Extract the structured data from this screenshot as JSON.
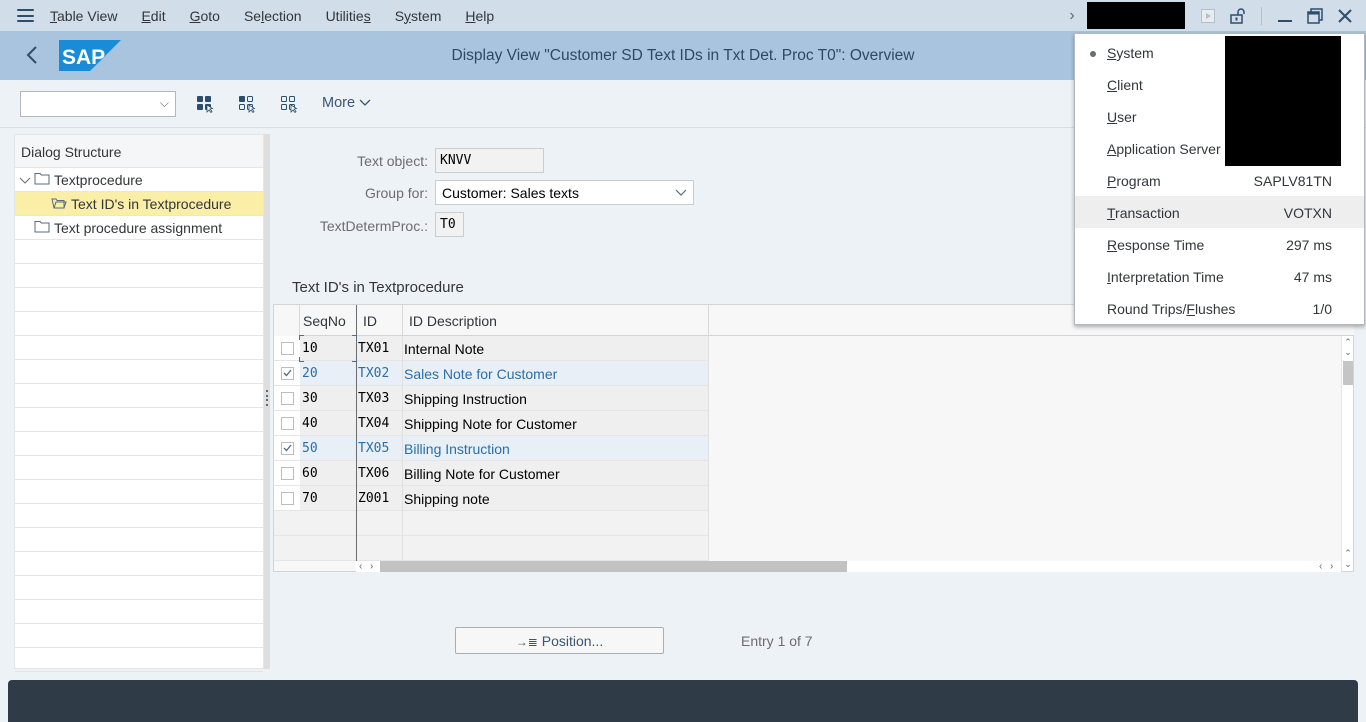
{
  "menubar": {
    "items": [
      {
        "label": "Table View",
        "mnemonic": "T"
      },
      {
        "label": "Edit",
        "mnemonic": "E"
      },
      {
        "label": "Goto",
        "mnemonic": "G"
      },
      {
        "label": "Selection",
        "mnemonic": "l"
      },
      {
        "label": "Utilities",
        "mnemonic": "s"
      },
      {
        "label": "System",
        "mnemonic": "y"
      },
      {
        "label": "Help",
        "mnemonic": "H"
      }
    ]
  },
  "titlebar": {
    "logo_text": "SAP",
    "title": "Display View \"Customer SD Text IDs in Txt Det. Proc T0\": Overview"
  },
  "toolbar": {
    "command_field_value": "",
    "more_label": "More"
  },
  "dialog_structure": {
    "header": "Dialog Structure",
    "items": [
      {
        "label": "Textprocedure",
        "level": 0,
        "expanded": true,
        "selected": false
      },
      {
        "label": "Text ID's in Textprocedure",
        "level": 1,
        "expanded": false,
        "selected": true
      },
      {
        "label": "Text procedure assignment",
        "level": 0,
        "expanded": false,
        "selected": false
      }
    ]
  },
  "form": {
    "text_object_label": "Text object:",
    "text_object_value": "KNVV",
    "group_for_label": "Group for:",
    "group_for_value": "Customer: Sales texts",
    "text_determ_proc_label": "TextDetermProc.:",
    "text_determ_proc_value": "T0"
  },
  "table": {
    "title": "Text ID's in Textprocedure",
    "columns": [
      "SeqNo",
      "ID",
      "ID Description"
    ],
    "rows": [
      {
        "seqno": "10",
        "id": "TX01",
        "description": "Internal Note",
        "checked": false
      },
      {
        "seqno": "20",
        "id": "TX02",
        "description": "Sales Note for Customer",
        "checked": true
      },
      {
        "seqno": "30",
        "id": "TX03",
        "description": "Shipping Instruction",
        "checked": false
      },
      {
        "seqno": "40",
        "id": "TX04",
        "description": "Shipping Note for Customer",
        "checked": false
      },
      {
        "seqno": "50",
        "id": "TX05",
        "description": "Billing Instruction",
        "checked": true
      },
      {
        "seqno": "60",
        "id": "TX06",
        "description": "Billing Note for Customer",
        "checked": false
      },
      {
        "seqno": "70",
        "id": "Z001",
        "description": "Shipping note",
        "checked": false
      }
    ]
  },
  "footer": {
    "position_button_label": "Position...",
    "entry_info": "Entry 1 of 7"
  },
  "system_info": {
    "rows": [
      {
        "label": "System",
        "mnemonic_index": 0,
        "value": "",
        "bullet": true
      },
      {
        "label": "Client",
        "mnemonic_index": 0,
        "value": ""
      },
      {
        "label": "User",
        "mnemonic_index": 0,
        "value": ""
      },
      {
        "label": "Application Server",
        "mnemonic_index": 0,
        "value": ""
      },
      {
        "label": "Program",
        "mnemonic_index": 0,
        "value": "SAPLV81TN"
      },
      {
        "label": "Transaction",
        "mnemonic_index": 0,
        "value": "VOTXN",
        "highlighted": true
      },
      {
        "label": "Response Time",
        "mnemonic_index": 0,
        "value": "297 ms"
      },
      {
        "label": "Interpretation Time",
        "mnemonic_index": 0,
        "value": "47 ms"
      },
      {
        "label": "Round Trips/Flushes",
        "mnemonic_index": 12,
        "value": "1/0"
      }
    ]
  }
}
